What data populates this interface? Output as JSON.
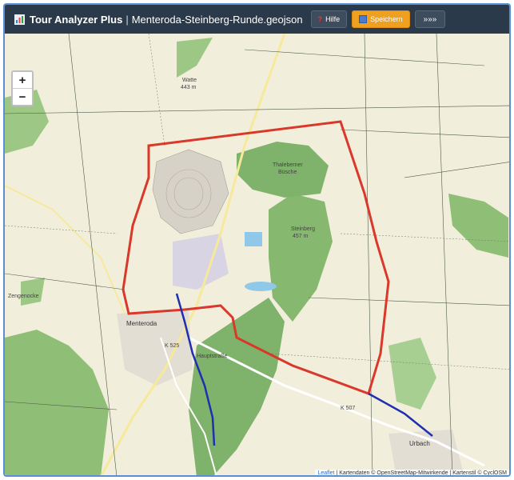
{
  "header": {
    "app_name": "Tour Analyzer Plus",
    "separator": "|",
    "file_name": "Menteroda-Steinberg-Runde.geojson",
    "help_label": "Hilfe",
    "save_label": "Speichern",
    "more_label": "»»»"
  },
  "map": {
    "zoom_in": "+",
    "zoom_out": "−",
    "labels": {
      "watte": "Watte",
      "watte_ele": "443 m",
      "thal_forest": "Thaleberner",
      "thal_forest2": "Büsche",
      "steinberg": "Steinberg",
      "steinberg_ele": "457 m",
      "menteroda": "Menteroda",
      "urbach": "Urbach",
      "zengenocke": "Zengenocke",
      "k507": "K 507",
      "k525": "K 525",
      "hauptstr": "Hauptstraße"
    },
    "attribution": {
      "leaflet": "Leaflet",
      "rest": " | Kartendaten © OpenStreetMap-Mitwirkende | Kartenstil © CyclOSM"
    },
    "colors": {
      "route_loop": "#d9382b",
      "route_access": "#1f2fb0",
      "forest": "#7fb26a",
      "farmland": "#f2eedc"
    }
  }
}
